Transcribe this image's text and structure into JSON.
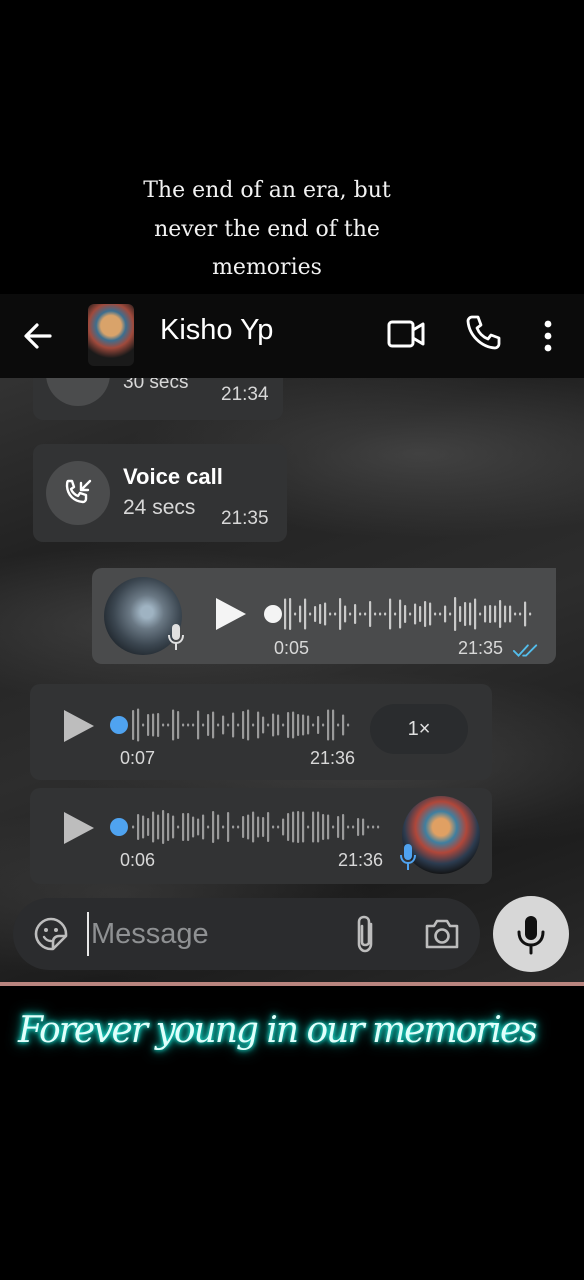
{
  "overlay": {
    "quote_lines": [
      "The end of an era, but",
      "never the end of the",
      "memories"
    ],
    "caption": "Forever young in our memories"
  },
  "header": {
    "contact_name": "Kisho Yp",
    "icons": [
      "back-arrow-icon",
      "video-call-icon",
      "phone-icon",
      "more-vert-icon"
    ]
  },
  "messages": [
    {
      "type": "call",
      "direction": "incoming",
      "duration": "30 secs",
      "time": "21:34"
    },
    {
      "type": "call",
      "direction": "incoming",
      "label": "Voice call",
      "duration": "24 secs",
      "time": "21:35"
    },
    {
      "type": "voice",
      "direction": "outgoing",
      "length": "0:05",
      "time": "21:35",
      "status": "read",
      "progress": 0
    },
    {
      "type": "voice",
      "direction": "incoming",
      "length": "0:07",
      "time": "21:36",
      "speed": "1×",
      "progress": 0
    },
    {
      "type": "voice",
      "direction": "incoming",
      "length": "0:06",
      "time": "21:36",
      "progress": 0
    }
  ],
  "composer": {
    "placeholder": "Message",
    "icons": [
      "sticker-icon",
      "attach-icon",
      "camera-icon",
      "mic-icon"
    ]
  },
  "colors": {
    "read_ticks": "#53bdeb",
    "voice_dot": "#4fa3f0",
    "caption_glow": "#1ff5e4"
  }
}
